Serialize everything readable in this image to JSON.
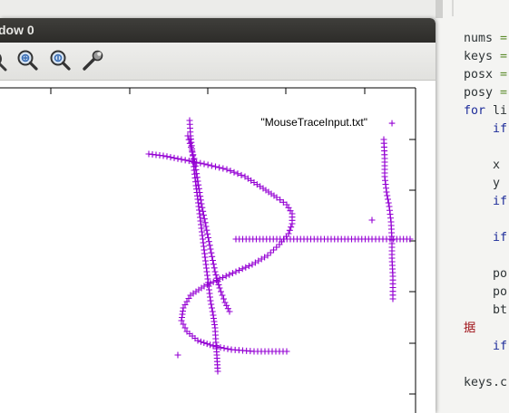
{
  "window": {
    "title": "dow 0"
  },
  "toolbar": {
    "buttons": [
      {
        "name": "zoom-partial-icon"
      },
      {
        "name": "zoom-in-icon"
      },
      {
        "name": "zoom-reset-icon"
      },
      {
        "name": "settings-wrench-icon"
      }
    ]
  },
  "plot": {
    "legend_label": "\"MouseTraceInput.txt\"",
    "legend_marker": "+",
    "point_color": "#9400d3"
  },
  "editor": {
    "lines": [
      {
        "a": "nums ",
        "b": "=",
        "c": ""
      },
      {
        "a": "keys ",
        "b": "=",
        "c": ""
      },
      {
        "a": "posx ",
        "b": "=",
        "c": ""
      },
      {
        "a": "posy ",
        "b": "=",
        "c": ""
      },
      {
        "kw": "for",
        "a": " li",
        "b": "",
        "c": ""
      },
      {
        "pad": "    ",
        "kw": "if",
        "a": "",
        "b": "",
        "c": ""
      },
      {
        "a": "",
        "b": "",
        "c": ""
      },
      {
        "pad": "    ",
        "a": "x",
        "b": "",
        "c": ""
      },
      {
        "pad": "    ",
        "a": "y",
        "b": "",
        "c": ""
      },
      {
        "pad": "    ",
        "kw": "if",
        "a": "",
        "b": "",
        "c": ""
      },
      {
        "a": "",
        "b": "",
        "c": ""
      },
      {
        "pad": "    ",
        "kw": "if",
        "a": "",
        "b": "",
        "c": ""
      },
      {
        "a": "",
        "b": "",
        "c": ""
      },
      {
        "pad": "    ",
        "a": "po",
        "b": "",
        "c": ""
      },
      {
        "pad": "    ",
        "a": "po",
        "b": "",
        "c": ""
      },
      {
        "pad": "    ",
        "a": "bt",
        "b": "",
        "c": ""
      },
      {
        "red": "据",
        "a": "",
        "b": "",
        "c": ""
      },
      {
        "pad": "    ",
        "kw": "if",
        "a": "",
        "b": "",
        "c": ""
      },
      {
        "a": "",
        "b": "",
        "c": ""
      },
      {
        "a": "keys.c",
        "b": "",
        "c": ""
      }
    ]
  },
  "chart_data": {
    "type": "scatter",
    "title": "",
    "xlabel": "",
    "ylabel": "",
    "grid": false,
    "legend": "top-right",
    "series": [
      {
        "name": "\"MouseTraceInput.txt\"",
        "strokes": [
          [
            [
              209,
              133
            ],
            [
              210,
              150
            ],
            [
              212,
              168
            ],
            [
              214,
              188
            ],
            [
              216,
              205
            ],
            [
              218,
              220
            ],
            [
              220,
              236
            ],
            [
              222,
              252
            ],
            [
              224,
              268
            ],
            [
              226,
              284
            ],
            [
              228,
              300
            ],
            [
              230,
              316
            ],
            [
              232,
              332
            ],
            [
              235,
              348
            ],
            [
              237,
              362
            ],
            [
              238,
              378
            ],
            [
              239,
              392
            ],
            [
              240,
              410
            ]
          ],
          [
            [
              164,
              170
            ],
            [
              180,
              172
            ],
            [
              200,
              176
            ],
            [
              225,
              181
            ],
            [
              250,
              187
            ],
            [
              270,
              195
            ],
            [
              290,
              208
            ],
            [
              305,
              218
            ],
            [
              316,
              226
            ],
            [
              322,
              236
            ],
            [
              322,
              247
            ],
            [
              318,
              258
            ],
            [
              308,
              270
            ],
            [
              295,
              282
            ],
            [
              278,
              292
            ],
            [
              260,
              300
            ],
            [
              242,
              308
            ],
            [
              225,
              316
            ],
            [
              210,
              326
            ],
            [
              202,
              340
            ],
            [
              200,
              354
            ],
            [
              206,
              366
            ],
            [
              218,
              376
            ],
            [
              235,
              382
            ],
            [
              255,
              386
            ],
            [
              280,
              388
            ],
            [
              300,
              388
            ],
            [
              316,
              388
            ]
          ],
          [
            [
              207,
              150
            ],
            [
              214,
              175
            ],
            [
              218,
              200
            ],
            [
              222,
              225
            ],
            [
              227,
              250
            ],
            [
              232,
              275
            ],
            [
              237,
              300
            ],
            [
              242,
              318
            ],
            [
              248,
              334
            ],
            [
              253,
              344
            ]
          ],
          [
            [
              260,
              264
            ],
            [
              290,
              264
            ],
            [
              320,
              264
            ],
            [
              350,
              264
            ],
            [
              380,
              264
            ],
            [
              410,
              264
            ],
            [
              430,
              264
            ],
            [
              452,
              264
            ]
          ],
          [
            [
              423,
              154
            ],
            [
              424,
              175
            ],
            [
              424,
              195
            ],
            [
              426,
              212
            ],
            [
              429,
              228
            ],
            [
              431,
              245
            ],
            [
              432,
              265
            ],
            [
              432,
              285
            ],
            [
              433,
              305
            ],
            [
              433,
              330
            ]
          ]
        ],
        "isolated_points": [
          [
            410,
            243
          ],
          [
            196,
            392
          ]
        ]
      }
    ]
  }
}
